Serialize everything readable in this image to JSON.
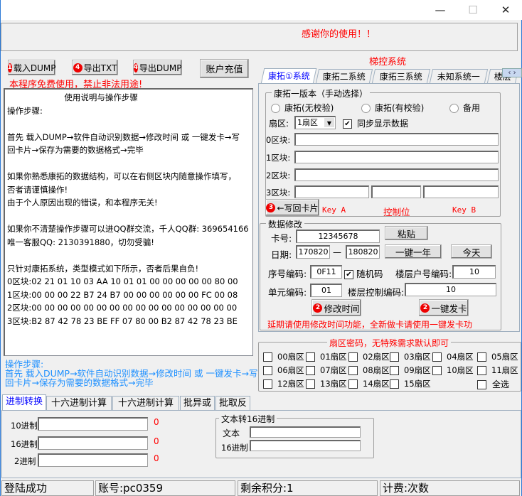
{
  "window": {
    "minimize": "—",
    "maximize": "☐",
    "close": "✕"
  },
  "banner": "感谢你的使用！！",
  "toolbar": {
    "load_dump": "载入DUMP",
    "load_num": "1",
    "export_txt": "导出TXT",
    "export_txt_num": "4",
    "export_dump": "导出DUMP",
    "export_dump_num": "4",
    "recharge": "账户充值"
  },
  "warning": "本程序免费使用，禁止非法用途!",
  "instructions": "                      使用说明与操作步骤\n操作步骤:\n\n首先 载入DUMP→软件自动识别数据→修改时间 或 一键发卡→写\n回卡片→保存为需要的数据格式→完毕\n\n如果你熟悉康拓的数据结构，可以在右侧区块内随意操作填写，\n否者请谨慎操作!\n由于个人原因出现的错误，和本程序无关!\n\n如果你不清楚操作步骤可以进QQ群交流，千人QQ群: 369654166\n唯一客服QQ: 2130391880，切勿受骗!\n\n只针对康拓系统，类型模式如下所示，否者后果自负!\n0区块:02 21 01 10 03 AA 10 01 01 00 00 00 00 00 80 00\n1区块:00 00 00 22 B7 24 B7 00 00 00 00 00 00 FC 00 08\n2区块:00 00 00 00 00 00 00 00 00 00 00 00 00 00 00 00\n3区块:B2 87 42 78 23 BE FF 07 80 00 B2 87 42 78 23 BE",
  "steps_hint": {
    "title": "操作步骤:",
    "line1": "首先 载入DUMP→软件自动识别数据→修改时间 或 一键发卡→写",
    "line2": "回卡片→保存为需要的数据格式→完毕"
  },
  "right": {
    "title": "梯控系统",
    "tabs": [
      "康拓①系统",
      "康拓二系统",
      "康拓三系统",
      "未知系统一",
      "楼层"
    ],
    "version_group": "康拓一版本（手动选择）",
    "radios": [
      "康拓(无校验)",
      "康拓(有校验)",
      "备用"
    ],
    "sector_label": "扇区:",
    "sector_value": "1扇区",
    "sync_label": "同步显示数据",
    "sync_checked": true,
    "blocks": [
      "0区块:",
      "1区块:",
      "2区块:",
      "3区块:"
    ],
    "write_back": "←写回卡片",
    "write_num": "3",
    "key_a": "Key A",
    "control_bits": "控制位",
    "key_b": "Key B",
    "modify_group": "数据修改",
    "card_label": "卡号:",
    "card_value": "12345678",
    "paste": "粘贴",
    "date_label": "日期:",
    "date_from": "170820",
    "date_sep": "—",
    "date_to": "180820",
    "one_year": "一键一年",
    "today": "今天",
    "serial_label": "序号编码:",
    "serial_value": "0F11",
    "random_label": "随机码",
    "random_checked": true,
    "floor_room_label": "楼层户号编码:",
    "floor_room_value": "10",
    "unit_label": "单元编码:",
    "unit_value": "01",
    "floor_ctrl_label": "楼层控制编码:",
    "floor_ctrl_value": "10",
    "modify_time": "修改时间",
    "issue_card": "一键发卡",
    "action_num": "2",
    "note": "延期请使用修改时间功能，全新做卡请使用一键发卡功",
    "sector_pwd_group": "扇区密码，无特殊需求默认即可",
    "sectors": [
      "00扇区",
      "01扇区",
      "02扇区",
      "03扇区",
      "04扇区",
      "05扇区",
      "06扇区",
      "07扇区",
      "08扇区",
      "09扇区",
      "10扇区",
      "11扇区",
      "12扇区",
      "13扇区",
      "14扇区",
      "15扇区"
    ],
    "select_all": "全选"
  },
  "bottom": {
    "tabs": [
      "进制转换",
      "十六进制计算",
      "十六进制计算",
      "批异或",
      "批取反"
    ],
    "dec_label": "10进制",
    "hex_label": "16进制",
    "bin_label": "2进制",
    "dec_len": "0",
    "hex_len": "0",
    "bin_len": "0",
    "text_group": "文本转16进制",
    "text_label": "文本",
    "text_hex_label": "16进制"
  },
  "status": {
    "login": "登陆成功",
    "account": "账号:pc0359",
    "points": "剩余积分:1",
    "billing": "计费:次数"
  }
}
